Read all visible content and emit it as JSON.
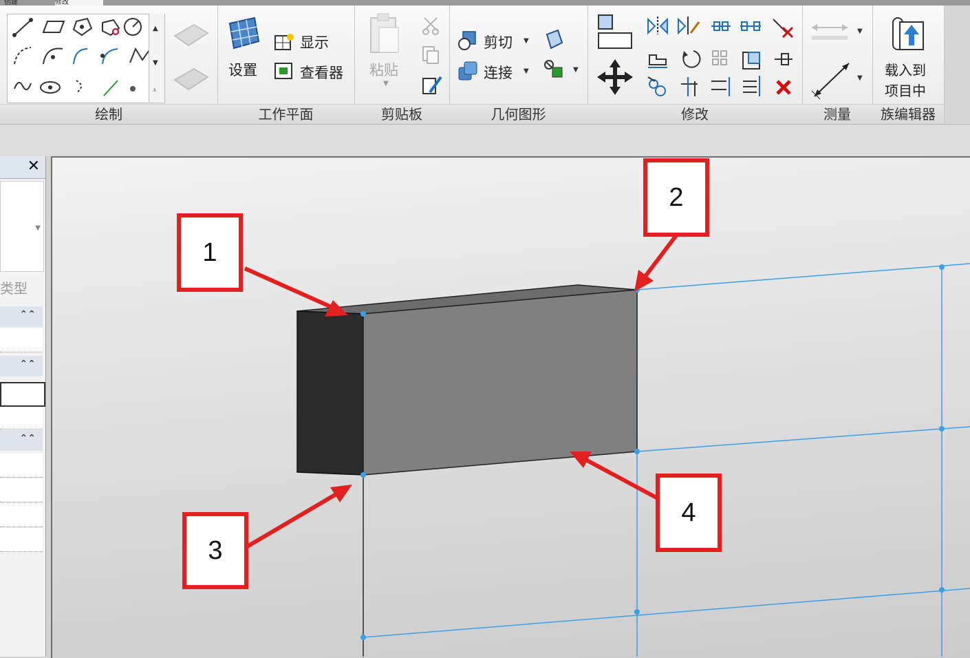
{
  "tabs": [
    "创建",
    "修改"
  ],
  "panels": {
    "draw": {
      "title": "绘制"
    },
    "workplane": {
      "title": "工作平面",
      "set_label": "设置",
      "show_label": "显示",
      "viewer_label": "查看器"
    },
    "clipboard": {
      "title": "剪贴板",
      "paste_label": "粘贴"
    },
    "geometry": {
      "title": "几何图形",
      "cut_label": "剪切",
      "join_label": "连接"
    },
    "modify": {
      "title": "修改"
    },
    "measure": {
      "title": "测量"
    },
    "family_editor": {
      "title": "族编辑器",
      "load_line1": "载入到",
      "load_line2": "项目中"
    }
  },
  "left_panel": {
    "type_label": "类型",
    "close_symbol": "✕"
  },
  "callouts": [
    "1",
    "2",
    "3",
    "4"
  ],
  "colors": {
    "accent_red": "#e1201f",
    "ref_blue": "#3aa0e6",
    "box_front": "#808080",
    "box_side": "#2b2b2b"
  }
}
